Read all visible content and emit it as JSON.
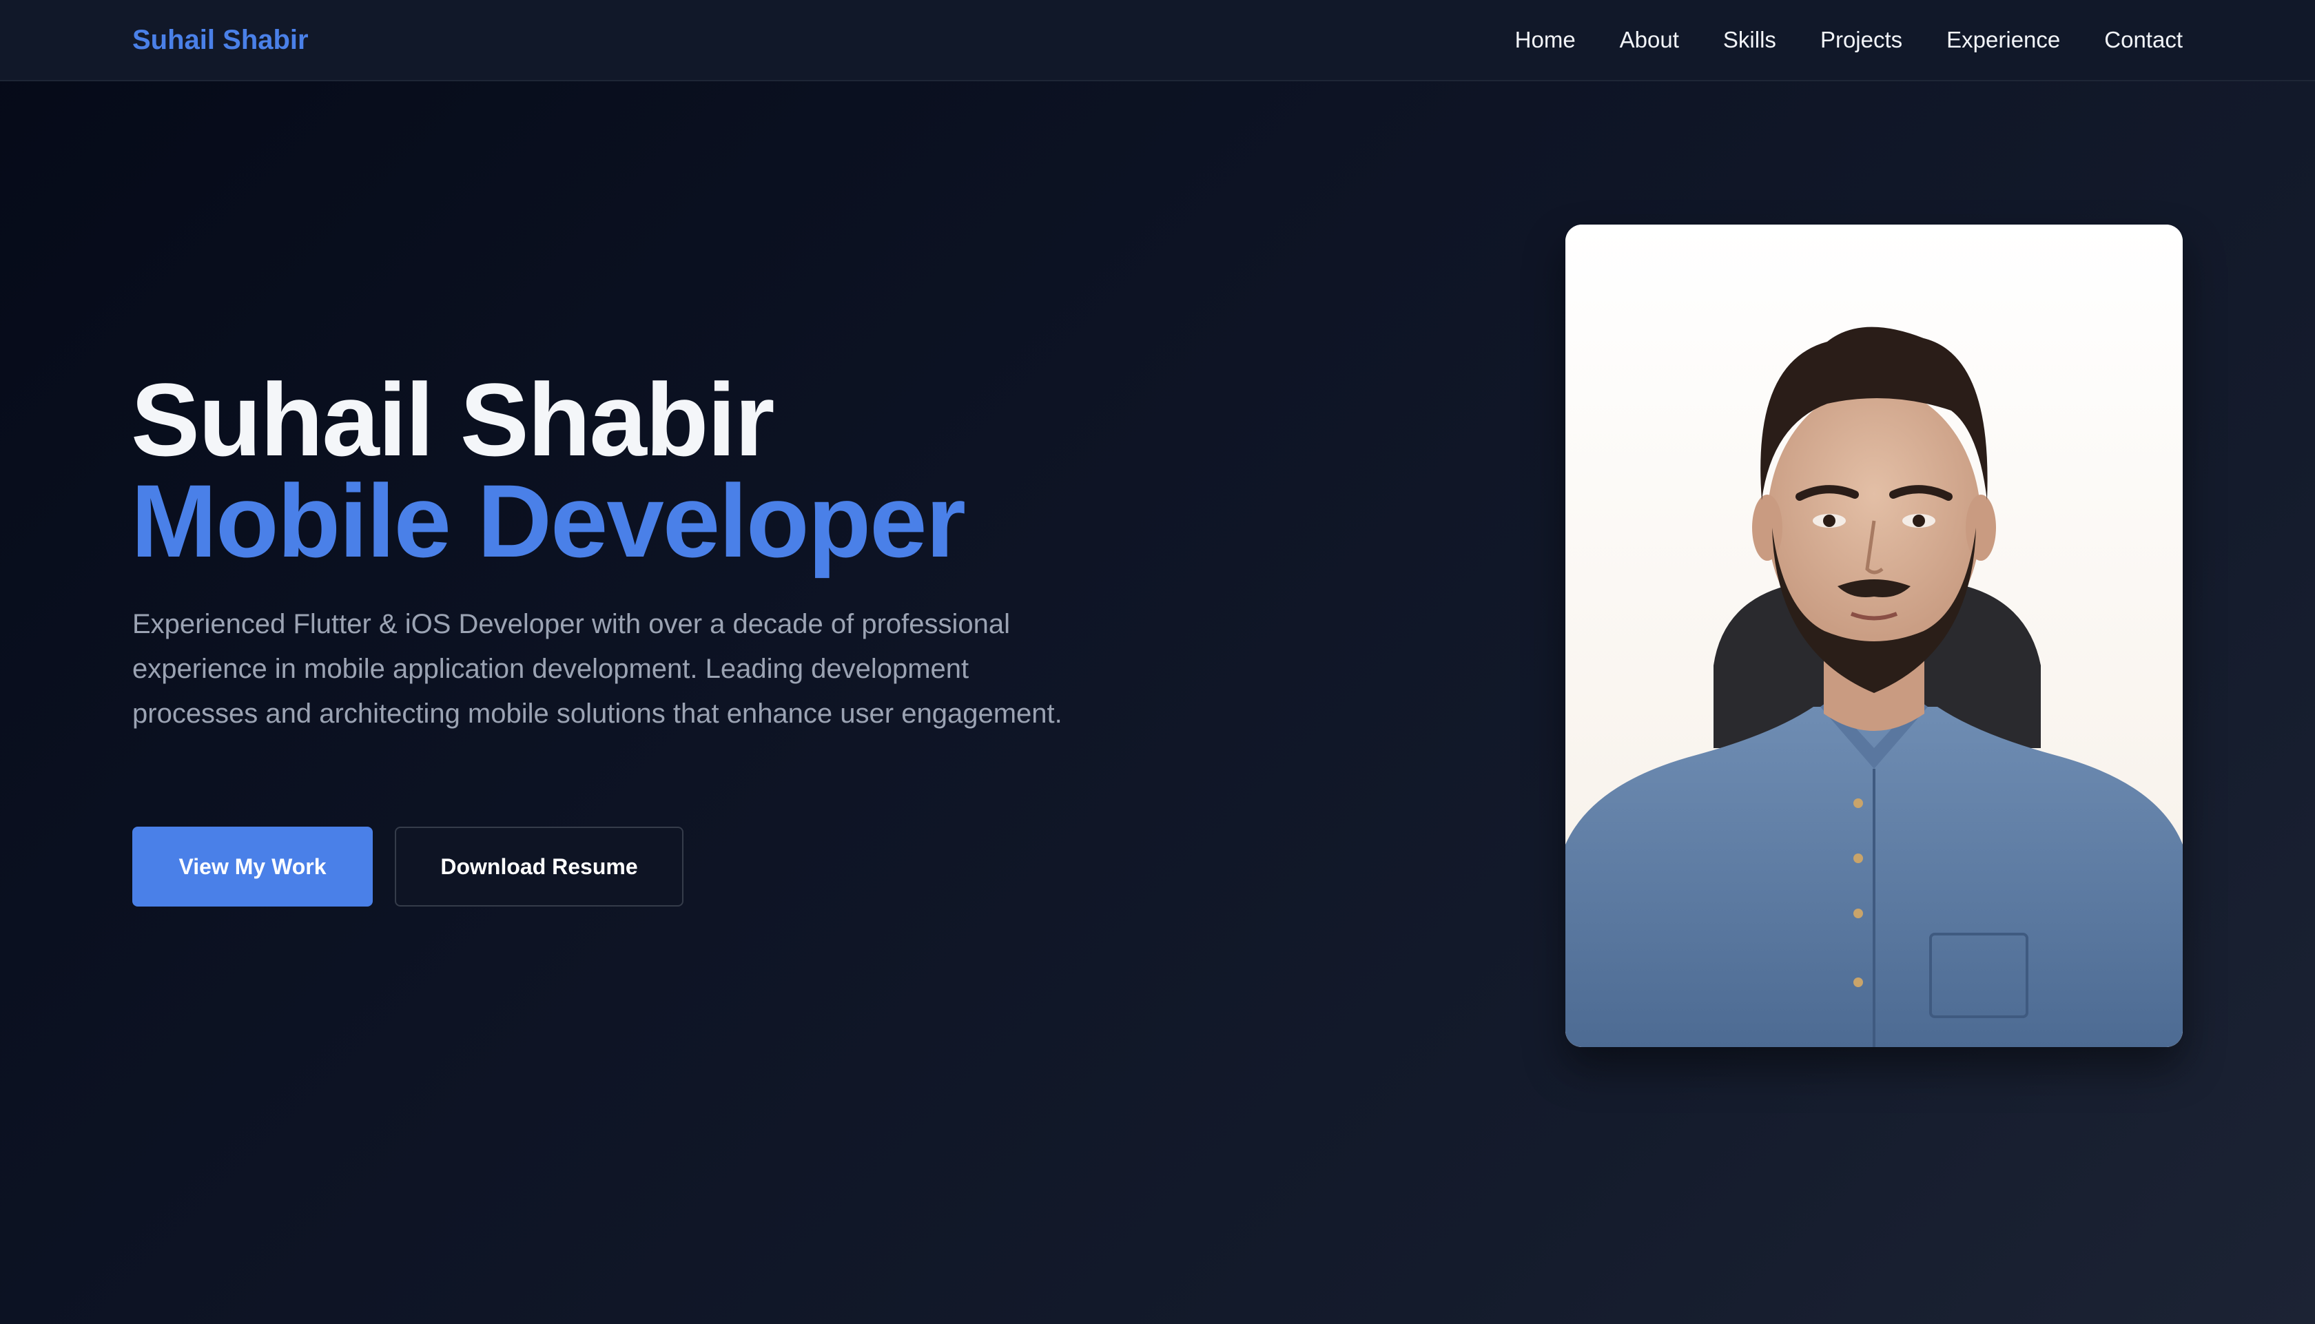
{
  "header": {
    "brand": "Suhail Shabir",
    "nav": [
      "Home",
      "About",
      "Skills",
      "Projects",
      "Experience",
      "Contact"
    ]
  },
  "hero": {
    "name": "Suhail Shabir",
    "role": "Mobile Developer",
    "description": "Experienced Flutter & iOS Developer with over a decade of professional experience in mobile application development. Leading development processes and architecting mobile solutions that enhance user engagement.",
    "primary_button": "View My Work",
    "secondary_button": "Download Resume"
  },
  "colors": {
    "accent": "#4a80e8",
    "background": "#0d1324",
    "navbar": "#111829",
    "text_muted": "#9ba3b3"
  },
  "icons": [
    "profile-photo"
  ]
}
